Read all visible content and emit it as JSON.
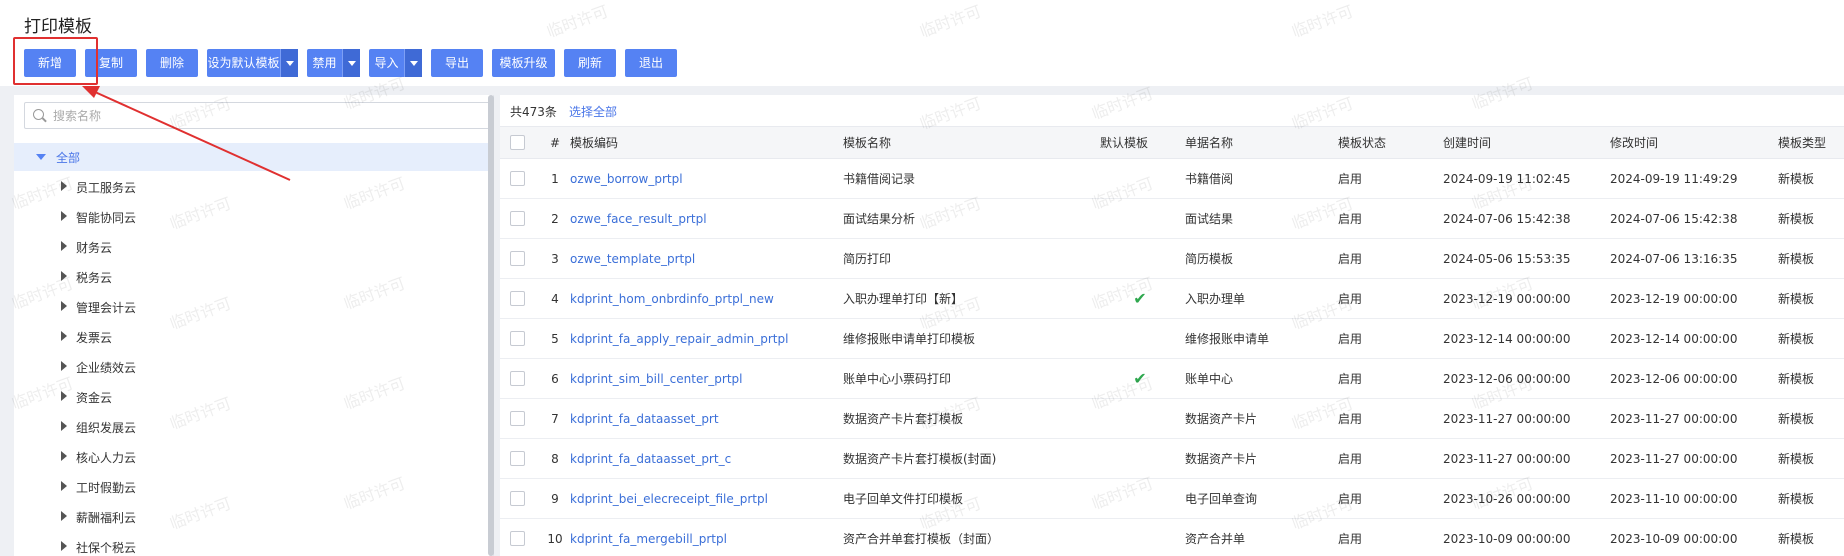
{
  "page_title": "打印模板",
  "toolbar": {
    "new": "新增",
    "copy": "复制",
    "delete": "删除",
    "set_default": "设为默认模板",
    "disable": "禁用",
    "import": "导入",
    "export": "导出",
    "upgrade": "模板升级",
    "refresh": "刷新",
    "exit": "退出"
  },
  "search": {
    "placeholder": "搜索名称"
  },
  "tree": {
    "root": "全部",
    "items": [
      "员工服务云",
      "智能协同云",
      "财务云",
      "税务云",
      "管理会计云",
      "发票云",
      "企业绩效云",
      "资金云",
      "组织发展云",
      "核心人力云",
      "工时假勤云",
      "薪酬福利云",
      "社保个税云"
    ]
  },
  "summary": {
    "count": "共473条",
    "select_all": "选择全部"
  },
  "table": {
    "headers": [
      "#",
      "模板编码",
      "模板名称",
      "默认模板",
      "单据名称",
      "模板状态",
      "创建时间",
      "修改时间",
      "模板类型"
    ],
    "rows": [
      {
        "no": "1",
        "code": "ozwe_borrow_prtpl",
        "name": "书籍借阅记录",
        "default": false,
        "bill": "书籍借阅",
        "status": "启用",
        "created": "2024-09-19 11:02:45",
        "modified": "2024-09-19 11:49:29",
        "type": "新模板"
      },
      {
        "no": "2",
        "code": "ozwe_face_result_prtpl",
        "name": "面试结果分析",
        "default": false,
        "bill": "面试结果",
        "status": "启用",
        "created": "2024-07-06 15:42:38",
        "modified": "2024-07-06 15:42:38",
        "type": "新模板"
      },
      {
        "no": "3",
        "code": "ozwe_template_prtpl",
        "name": "简历打印",
        "default": false,
        "bill": "简历模板",
        "status": "启用",
        "created": "2024-05-06 15:53:35",
        "modified": "2024-07-06 13:16:35",
        "type": "新模板"
      },
      {
        "no": "4",
        "code": "kdprint_hom_onbrdinfo_prtpl_new",
        "name": "入职办理单打印【新】",
        "default": true,
        "bill": "入职办理单",
        "status": "启用",
        "created": "2023-12-19 00:00:00",
        "modified": "2023-12-19 00:00:00",
        "type": "新模板"
      },
      {
        "no": "5",
        "code": "kdprint_fa_apply_repair_admin_prtpl",
        "name": "维修报账申请单打印模板",
        "default": false,
        "bill": "维修报账申请单",
        "status": "启用",
        "created": "2023-12-14 00:00:00",
        "modified": "2023-12-14 00:00:00",
        "type": "新模板"
      },
      {
        "no": "6",
        "code": "kdprint_sim_bill_center_prtpl",
        "name": "账单中心小票码打印",
        "default": true,
        "bill": "账单中心",
        "status": "启用",
        "created": "2023-12-06 00:00:00",
        "modified": "2023-12-06 00:00:00",
        "type": "新模板"
      },
      {
        "no": "7",
        "code": "kdprint_fa_dataasset_prt",
        "name": "数据资产卡片套打模板",
        "default": false,
        "bill": "数据资产卡片",
        "status": "启用",
        "created": "2023-11-27 00:00:00",
        "modified": "2023-11-27 00:00:00",
        "type": "新模板"
      },
      {
        "no": "8",
        "code": "kdprint_fa_dataasset_prt_c",
        "name": "数据资产卡片套打模板(封面)",
        "default": false,
        "bill": "数据资产卡片",
        "status": "启用",
        "created": "2023-11-27 00:00:00",
        "modified": "2023-11-27 00:00:00",
        "type": "新模板"
      },
      {
        "no": "9",
        "code": "kdprint_bei_elecreceipt_file_prtpl",
        "name": "电子回单文件打印模板",
        "default": false,
        "bill": "电子回单查询",
        "status": "启用",
        "created": "2023-10-26 00:00:00",
        "modified": "2023-11-10 00:00:00",
        "type": "新模板"
      },
      {
        "no": "10",
        "code": "kdprint_fa_mergebill_prtpl",
        "name": "资产合并单套打模板（封面）",
        "default": false,
        "bill": "资产合并单",
        "status": "启用",
        "created": "2023-10-09 00:00:00",
        "modified": "2023-10-09 00:00:00",
        "type": "新模板"
      }
    ]
  },
  "default_check_icon": "✔",
  "watermark": "临时许可",
  "colors": {
    "primary": "#5582f3",
    "link": "#3b6fd8",
    "highlight": "#e03030",
    "check": "#2fa84f"
  }
}
